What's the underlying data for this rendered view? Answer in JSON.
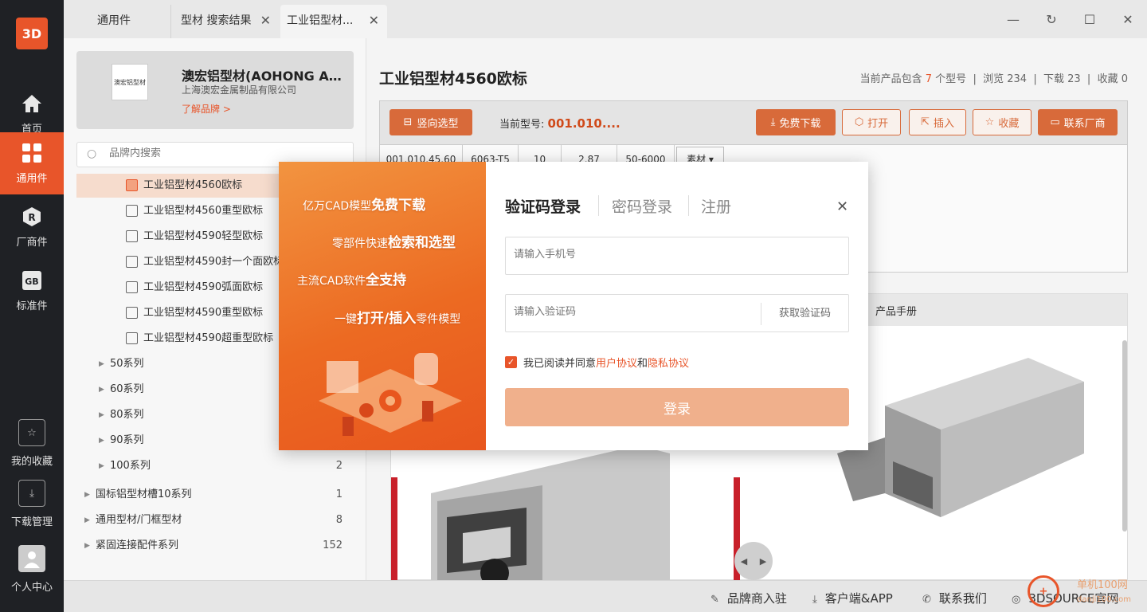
{
  "app": {
    "logo_text": "3D",
    "accent": "#e8552a"
  },
  "rail": {
    "items": [
      {
        "label": "首页",
        "icon": "home-icon"
      },
      {
        "label": "通用件",
        "icon": "grid-icon"
      },
      {
        "label": "厂商件",
        "icon": "r-badge-icon",
        "badge": "R"
      },
      {
        "label": "标准件",
        "icon": "gb-badge-icon",
        "badge": "GB"
      }
    ],
    "bottom": [
      {
        "label": "我的收藏",
        "icon": "star-folder-icon"
      },
      {
        "label": "下载管理",
        "icon": "download-icon"
      },
      {
        "label": "个人中心",
        "icon": "user-icon"
      }
    ]
  },
  "tabs": [
    {
      "label": "通用件"
    },
    {
      "label": "型材 搜索结果"
    },
    {
      "label": "工业铝型材..."
    }
  ],
  "brand": {
    "logo_text": "澳宏铝型材",
    "name": "澳宏铝型材(AOHONG ALUMINUM)",
    "company": "上海澳宏金属制品有限公司",
    "link": "了解品牌 >"
  },
  "search": {
    "placeholder": "品牌内搜索"
  },
  "tree": {
    "products": [
      "工业铝型材4560欧标",
      "工业铝型材4560重型欧标",
      "工业铝型材4590轻型欧标",
      "工业铝型材4590封一个面欧标",
      "工业铝型材4590弧面欧标",
      "工业铝型材4590重型欧标",
      "工业铝型材4590超重型欧标"
    ],
    "series": [
      {
        "label": "50系列",
        "count": ""
      },
      {
        "label": "60系列",
        "count": ""
      },
      {
        "label": "80系列",
        "count": ""
      },
      {
        "label": "90系列",
        "count": ""
      },
      {
        "label": "100系列",
        "count": "2"
      }
    ],
    "groups": [
      {
        "label": "国标铝型材槽10系列",
        "count": "1"
      },
      {
        "label": "通用型材/门框型材",
        "count": "8"
      },
      {
        "label": "紧固连接配件系列",
        "count": "152"
      }
    ]
  },
  "product": {
    "title": "工业铝型材4560欧标",
    "stats_prefix": "当前产品包含",
    "model_count": "7",
    "stats_models": "个型号",
    "views": "浏览 234",
    "downloads": "下载 23",
    "favorites": "收藏 0"
  },
  "toolbar": {
    "vertical_select": "竖向选型",
    "current_model_label": "当前型号:",
    "current_model": "001.010....",
    "free_download": "免费下载",
    "open": "打开",
    "insert": "插入",
    "favorite": "收藏",
    "contact": "联系厂商"
  },
  "table": {
    "cells": [
      "001.010.45.60",
      "6063-T5",
      "10",
      "2.87",
      "50-6000",
      "素材"
    ]
  },
  "panel": {
    "tab_manual": "产品手册"
  },
  "footer": {
    "brand_join": "品牌商入驻",
    "client": "客户端&APP",
    "contact": "联系我们",
    "official": "3DSOURCE官网"
  },
  "watermark": {
    "line1": "单机100网",
    "line2": "danji100.com"
  },
  "modal": {
    "promo": [
      {
        "pre": "亿万CAD模型",
        "bold": "免费下载",
        "post": ""
      },
      {
        "pre": "零部件快速",
        "bold": "检索和选型",
        "post": ""
      },
      {
        "pre": "主流CAD软件",
        "bold": "全支持",
        "post": ""
      },
      {
        "pre": "一键",
        "bold": "打开/插入",
        "post": "零件模型"
      }
    ],
    "tab_sms": "验证码登录",
    "tab_password": "密码登录",
    "tab_register": "注册",
    "phone_placeholder": "请输入手机号",
    "code_placeholder": "请输入验证码",
    "get_code": "获取验证码",
    "agree_pre": "我已阅读并同意",
    "agree_user": "用户协议",
    "agree_and": "和",
    "agree_privacy": "隐私协议",
    "login": "登录"
  }
}
